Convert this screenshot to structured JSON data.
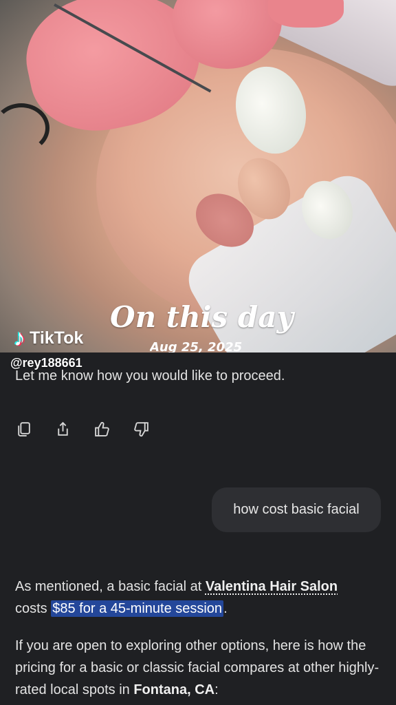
{
  "video": {
    "overlay_title": "On this day",
    "overlay_date": "Aug 25, 2025",
    "brand": "TikTok",
    "handle": "@rey188661"
  },
  "chat": {
    "assistant_prev": "Let me know how you would like to proceed.",
    "actions": [
      {
        "name": "copy-icon"
      },
      {
        "name": "share-icon"
      },
      {
        "name": "thumbs-up-icon"
      },
      {
        "name": "thumbs-down-icon"
      }
    ],
    "user_message": "how cost basic facial",
    "answer": {
      "p1_before": "As mentioned, a basic facial at ",
      "p1_salon": "Valentina Hair Salon",
      "p1_mid": "costs ",
      "p1_price": "$85 for a 45-minute session",
      "p1_end": ".",
      "p2_text": "If you are open to exploring other options, here is how the pricing for a basic or classic facial compares at other highly-rated local spots in ",
      "p2_city": "Fontana, CA",
      "p2_end": ":"
    }
  },
  "colors": {
    "background": "#1f2023",
    "user_bubble": "#2e2f33",
    "highlight": "#24479a",
    "glove": "#f08a94"
  }
}
